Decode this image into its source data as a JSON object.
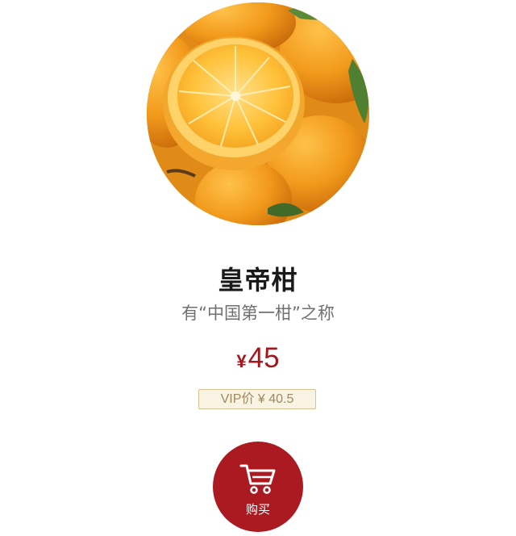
{
  "product": {
    "name": "皇帝柑",
    "tagline": "有“中国第一柑”之称",
    "price_symbol": "¥",
    "price_value": "45",
    "vip_price": "VIP价 ¥ 40.5"
  },
  "buy_button": {
    "label": "购买",
    "icon": "shopping-cart-icon"
  },
  "colors": {
    "accent": "#ac1a21",
    "price": "#a3161c",
    "vip_border": "#d6c394",
    "vip_background": "#f8f3e3",
    "vip_text": "#9e8a5c"
  }
}
